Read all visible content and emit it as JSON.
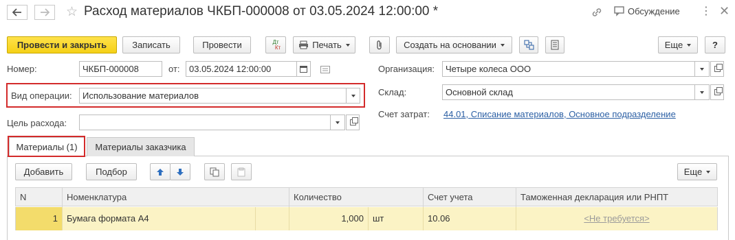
{
  "header": {
    "title": "Расход материалов ЧКБП-000008 от 03.05.2024 12:00:00 *",
    "discussion_label": "Обсуждение",
    "icons": [
      "back-arrow-icon",
      "forward-arrow-icon",
      "star-icon",
      "link-icon",
      "chat-icon",
      "more-vertical-icon",
      "close-icon"
    ]
  },
  "toolbar": {
    "post_and_close": "Провести и закрыть",
    "save": "Записать",
    "post": "Провести",
    "dt_label": "Дт",
    "kt_label": "Кт",
    "print": "Печать",
    "create_based_on": "Создать на основании",
    "more": "Еще",
    "help": "?"
  },
  "form": {
    "number_label": "Номер:",
    "number_value": "ЧКБП-000008",
    "from_label": "от:",
    "date_value": "03.05.2024 12:00:00",
    "operation_label": "Вид операции:",
    "operation_value": "Использование материалов",
    "purpose_label": "Цель расхода:",
    "purpose_value": "",
    "org_label": "Организация:",
    "org_value": "Четыре колеса ООО",
    "warehouse_label": "Склад:",
    "warehouse_value": "Основной склад",
    "cost_account_label": "Счет затрат:",
    "cost_account_value": "44.01, Списание материалов, Основное подразделение"
  },
  "tabs": [
    {
      "label": "Материалы (1)",
      "active": true
    },
    {
      "label": "Материалы заказчика",
      "active": false
    }
  ],
  "table_toolbar": {
    "add": "Добавить",
    "pick": "Подбор",
    "more": "Еще"
  },
  "table": {
    "columns": [
      "N",
      "Номенклатура",
      "Количество",
      "Счет учета",
      "Таможенная декларация или РНПТ"
    ],
    "rows": [
      {
        "n": "1",
        "item": "Бумага формата А4",
        "qty": "1,000",
        "unit": "шт",
        "account": "10.06",
        "declaration": "<Не требуется>"
      }
    ]
  },
  "colors": {
    "primary_button": "#f5d017",
    "highlight_frame": "#d32a2a",
    "selected_row": "#fbf3c5",
    "link": "#2b5fa4"
  }
}
